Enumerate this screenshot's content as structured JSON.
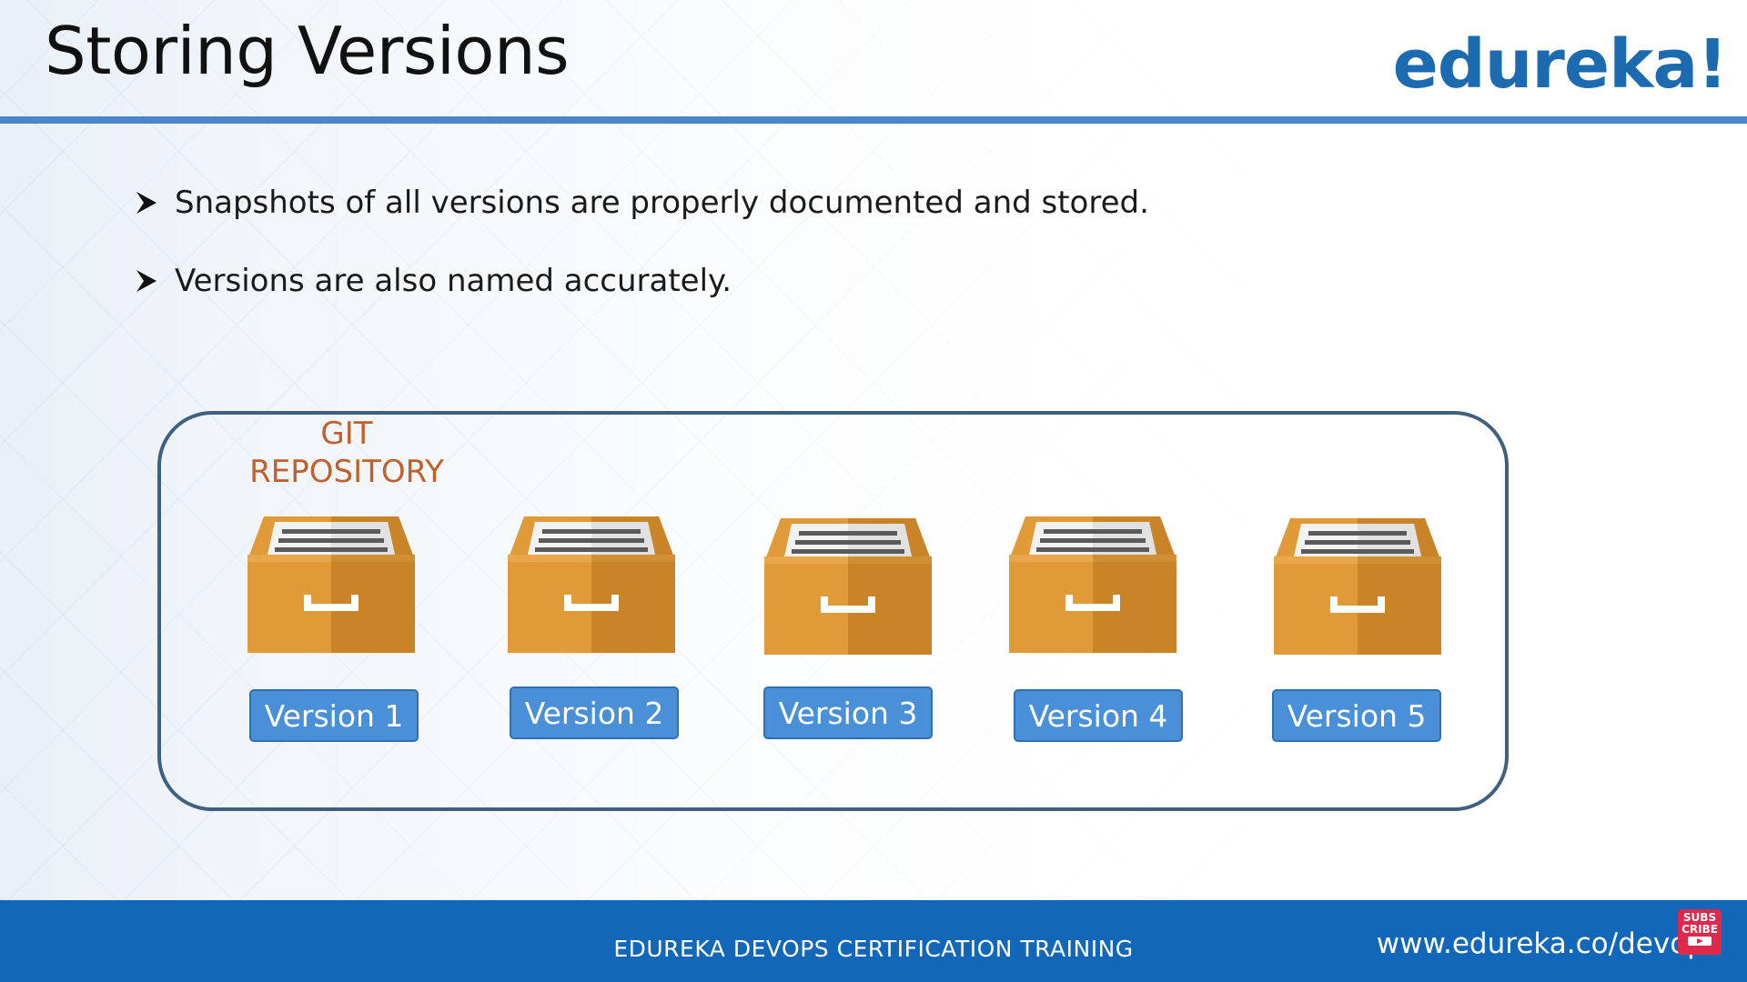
{
  "slide": {
    "title": "Storing Versions",
    "logo": "edureka!"
  },
  "bullets": [
    "Snapshots of all versions are properly documented and stored.",
    "Versions are also named accurately."
  ],
  "repository": {
    "label_line1": "GIT",
    "label_line2": "REPOSITORY",
    "versions": [
      "Version 1",
      "Version 2",
      "Version 3",
      "Version 4",
      "Version 5"
    ]
  },
  "footer": {
    "course": "EDUREKA DEVOPS CERTIFICATION TRAINING",
    "url": "www.edureka.co/devops"
  },
  "subscribe": {
    "line1": "SUBS",
    "line2": "CRIBE"
  },
  "colors": {
    "title_rule": "#4a86c8",
    "logo": "#1c6ab0",
    "repo_label": "#c0612d",
    "cabinet_body": "#e09b38",
    "version_button": "#4a90d9",
    "footer": "#1267b8",
    "repo_border": "#3f607f"
  },
  "icons": {
    "bullet": "arrowhead-bullet-icon",
    "cabinet": "file-drawer-icon",
    "subscribe": "subscribe-badge-icon"
  }
}
